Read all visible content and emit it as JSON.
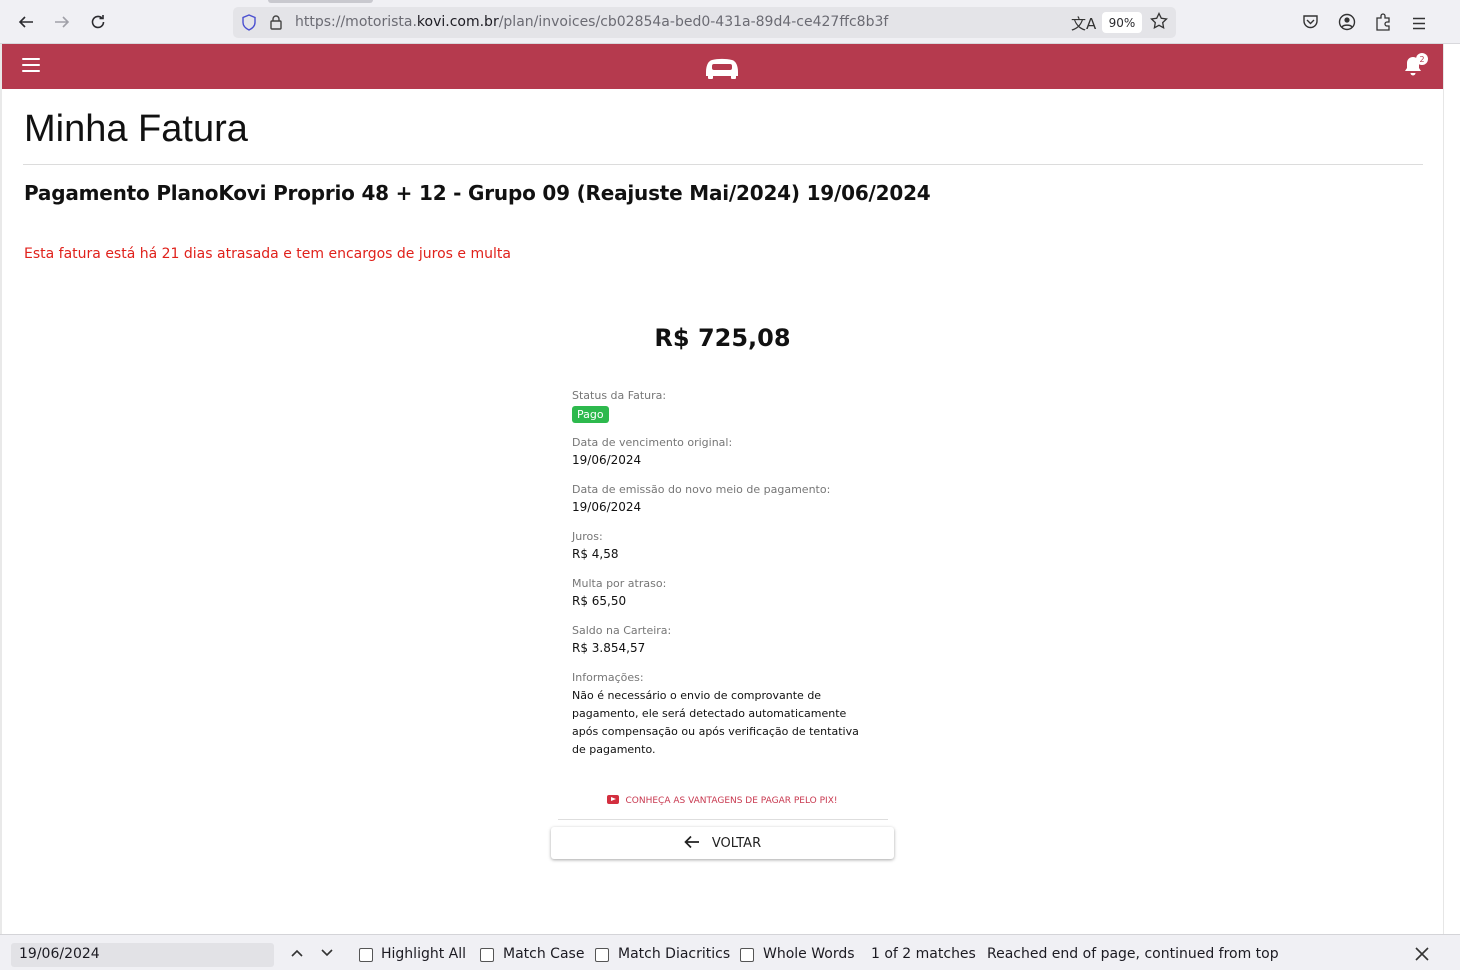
{
  "browser": {
    "url_prefix": "https://motorista.",
    "url_domain": "kovi.com.br",
    "url_path": "/plan/invoices/cb02854a-bed0-431a-89d4-ce427ffc8b3f",
    "zoom": "90%"
  },
  "header": {
    "notification_count": "2"
  },
  "page": {
    "title": "Minha Fatura",
    "invoice_heading": "Pagamento PlanoKovi Proprio 48 + 12 - Grupo 09 (Reajuste Mai/2024) 19/06/2024",
    "overdue_note": "Esta fatura está há 21 dias atrasada e tem encargos de juros e multa",
    "amount": "R$ 725,08"
  },
  "details": {
    "status_label": "Status da Fatura:",
    "status_value": "Pago",
    "due_date_label": "Data de vencimento original:",
    "due_date_value": "19/06/2024",
    "issue_date_label": "Data de emissão do novo meio de pagamento:",
    "issue_date_value": "19/06/2024",
    "interest_label": "Juros:",
    "interest_value": "R$ 4,58",
    "fine_label": "Multa por atraso:",
    "fine_value": "R$ 65,50",
    "wallet_label": "Saldo na Carteira:",
    "wallet_value": "R$ 3.854,57",
    "info_label": "Informações:",
    "info_value": "Não é necessário o envio de comprovante de pagamento, ele será detectado automaticamente após compensação ou após verificação de tentativa de pagamento."
  },
  "actions": {
    "pix_link": "CONHEÇA AS VANTAGENS DE PAGAR PELO PIX!",
    "back_label": "VOLTAR"
  },
  "find_bar": {
    "query": "19/06/2024",
    "highlight_all": "Highlight All",
    "match_case": "Match Case",
    "match_diacritics": "Match Diacritics",
    "whole_words": "Whole Words",
    "match_count": "1 of 2 matches",
    "status": "Reached end of page, continued from top"
  },
  "colors": {
    "header_bg": "#b53a4e",
    "overdue_text": "#e0211b",
    "status_paid": "#2db94d",
    "pix_link": "#c8384f"
  },
  "icons": [
    "back-icon",
    "forward-icon",
    "reload-icon",
    "shield-icon",
    "lock-icon",
    "translate-icon",
    "star-icon",
    "pocket-icon",
    "account-icon",
    "extensions-icon",
    "menu-icon",
    "hamburger-icon",
    "car-logo-icon",
    "bell-icon",
    "youtube-icon",
    "arrow-left-icon",
    "chevron-up-icon",
    "chevron-down-icon",
    "close-icon"
  ]
}
